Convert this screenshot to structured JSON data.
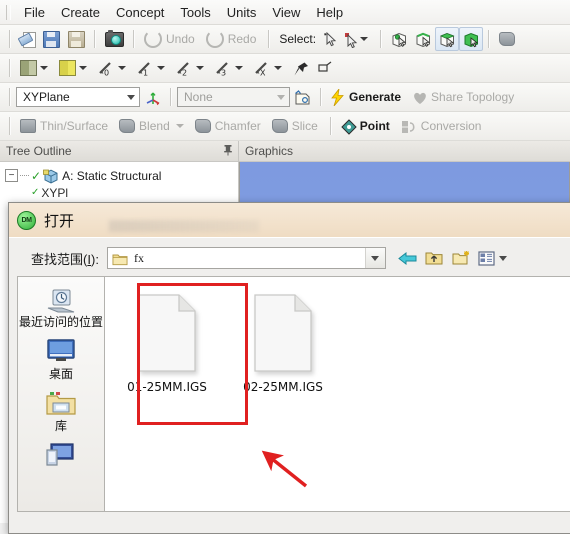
{
  "app": {
    "menu": [
      "File",
      "Create",
      "Concept",
      "Tools",
      "Units",
      "View",
      "Help"
    ],
    "toolbar1": {
      "new_label": "new-sheet-icon",
      "save_label": "save-icon",
      "saveas_label": "save-as-icon",
      "camera_label": "camera-icon",
      "undo_label": "Undo",
      "redo_label": "Redo",
      "select_label": "Select:",
      "select_single": "select-single-cursor-icon",
      "select_box": "select-box-cursor-icon",
      "mode_vertex": "vertex-select-icon",
      "mode_edge": "edge-select-icon",
      "mode_face": "face-select-icon",
      "mode_body": "body-select-icon"
    },
    "toolbar2": {
      "plane_label": "plane-icon",
      "sketch_label": "sketch-icon",
      "extrude_label": "extrude-0-icon",
      "revolve_label": "revolve-1-icon",
      "sweep_label": "sweep-2-icon",
      "skinloft_label": "skin-loft-3-icon",
      "thin_label": "thin-x-icon",
      "pin_label": "pin-tool-icon",
      "flag_label": "flag-tool-icon"
    },
    "toolbar3": {
      "plane_value": "XYPlane",
      "sketch_value": "None",
      "new_sketch_label": "new-sketch-icon",
      "axes_label": "axes-icon",
      "generate_label": "Generate",
      "share_topology_label": "Share Topology"
    },
    "toolbar4": {
      "thin_surface_label": "Thin/Surface",
      "blend_label": "Blend",
      "chamfer_label": "Chamfer",
      "slice_label": "Slice",
      "point_label": "Point",
      "conversion_label": "Conversion"
    },
    "left_panel": {
      "title": "Tree Outline",
      "pin": "pin-icon",
      "tree": [
        {
          "label": "A: Static Structural",
          "expander": "−",
          "check": "✓"
        },
        {
          "label": "XYPl",
          "expander": "",
          "check": ""
        }
      ]
    },
    "right_panel": {
      "title": "Graphics"
    }
  },
  "dialog": {
    "title": "打开",
    "app_icon": "DM",
    "look_in": {
      "label_main": "查找范围",
      "label_accel": "I",
      "label_colon": ":",
      "value": "fx"
    },
    "nav": {
      "back": "back-arrow-icon",
      "up": "up-one-level-icon",
      "new_folder": "new-folder-icon",
      "views": "views-icon"
    },
    "places": [
      {
        "label": "最近访问的位置",
        "icon": "recent-places-icon"
      },
      {
        "label": "桌面",
        "icon": "desktop-icon"
      },
      {
        "label": "库",
        "icon": "libraries-icon"
      },
      {
        "label": "",
        "icon": "computer-icon"
      }
    ],
    "files": [
      {
        "name": "01-25MM.IGS",
        "icon": "generic-file-icon",
        "highlighted": true
      },
      {
        "name": "02-25MM.IGS",
        "icon": "generic-file-icon",
        "highlighted": false
      }
    ]
  },
  "annotations": {
    "box_color": "#e02020",
    "arrow_color": "#e02020"
  }
}
